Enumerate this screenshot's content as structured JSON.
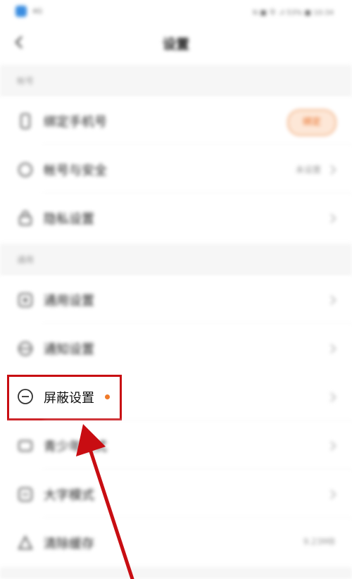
{
  "status_bar": {
    "left_text": "4G",
    "right_text": "N ■ 令 .ıl 53% ■ 10:34"
  },
  "header": {
    "title": "设置"
  },
  "sections": [
    {
      "title": "帐号"
    },
    {
      "title": "通用"
    }
  ],
  "rows": {
    "bind_phone": {
      "label": "绑定手机号",
      "pill": "绑定"
    },
    "account_security": {
      "label": "帐号与安全",
      "value": "未设置"
    },
    "privacy": {
      "label": "隐私设置"
    },
    "general": {
      "label": "通用设置"
    },
    "notification": {
      "label": "通知设置"
    },
    "shield": {
      "label": "屏蔽设置"
    },
    "teen_mode": {
      "label": "青少年模式"
    },
    "large_font": {
      "label": "大字模式"
    },
    "clear_cache": {
      "label": "清除缓存",
      "value": "9.23MB"
    }
  },
  "colors": {
    "accent": "#f07a2a",
    "highlight": "#c80d12",
    "section_bg": "#f6f6f6"
  }
}
